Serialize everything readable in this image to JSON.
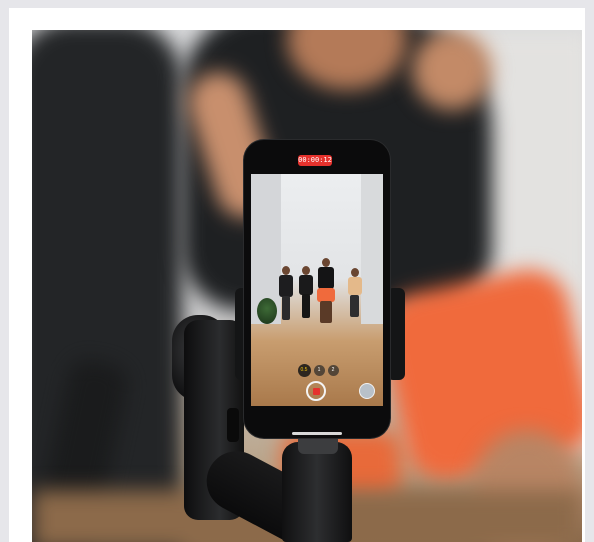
{
  "image": {
    "recording_timer": "00:00:12",
    "zoom_levels": [
      "0.5",
      "1",
      "2"
    ],
    "colors": {
      "record_red": "#e5322d",
      "shorts_orange": "#f06a3c",
      "gimbal_black": "#141516"
    }
  }
}
